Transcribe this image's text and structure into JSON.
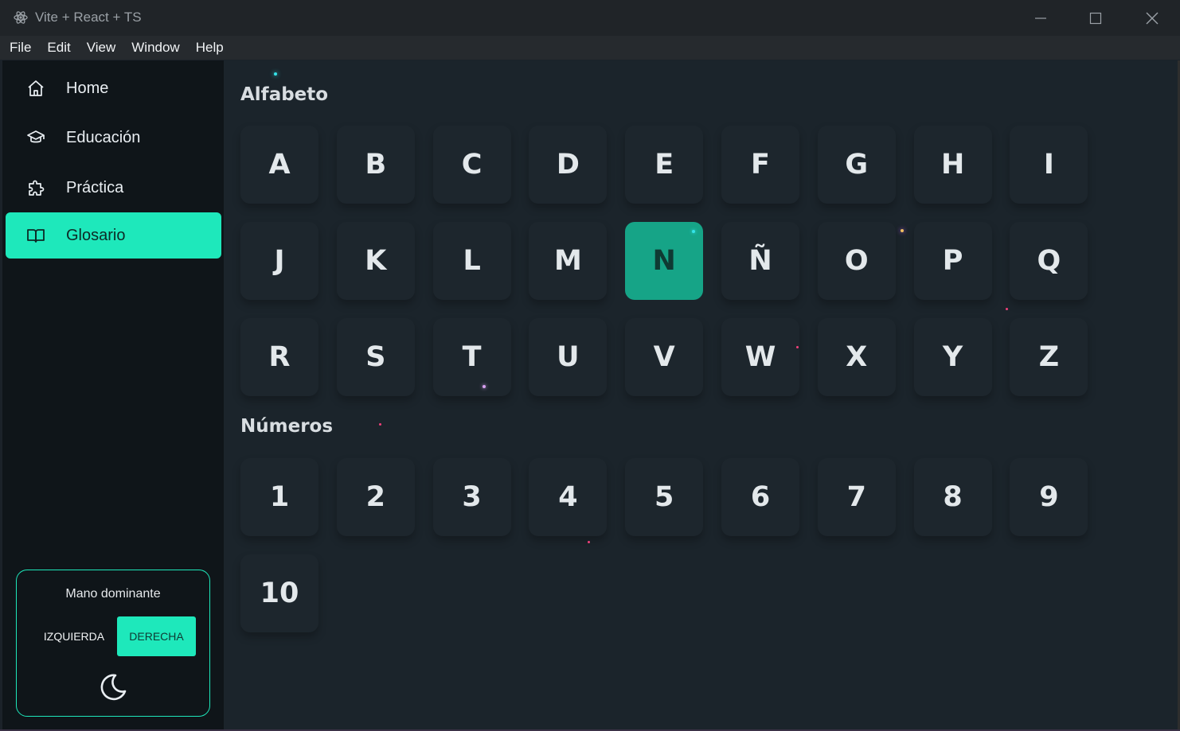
{
  "window": {
    "title": "Vite + React + TS"
  },
  "menu": [
    "File",
    "Edit",
    "View",
    "Window",
    "Help"
  ],
  "sidebar": {
    "items": [
      {
        "label": "Home",
        "icon": "home-icon"
      },
      {
        "label": "Educación",
        "icon": "graduation-cap-icon"
      },
      {
        "label": "Práctica",
        "icon": "puzzle-icon"
      },
      {
        "label": "Glosario",
        "icon": "book-open-icon",
        "active": true
      }
    ],
    "hand": {
      "title": "Mano dominante",
      "left_label": "IZQUIERDA",
      "right_label": "DERECHA",
      "selected": "DERECHA",
      "theme_icon": "moon-icon"
    }
  },
  "main": {
    "alphabet_title": "Alfabeto",
    "letters": [
      "A",
      "B",
      "C",
      "D",
      "E",
      "F",
      "G",
      "H",
      "I",
      "J",
      "K",
      "L",
      "M",
      "N",
      "Ñ",
      "O",
      "P",
      "Q",
      "R",
      "S",
      "T",
      "U",
      "V",
      "W",
      "X",
      "Y",
      "Z"
    ],
    "selected_letter": "N",
    "numbers_title": "Números",
    "numbers": [
      "1",
      "2",
      "3",
      "4",
      "5",
      "6",
      "7",
      "8",
      "9",
      "10"
    ]
  },
  "colors": {
    "accent": "#1ee8bb",
    "selected_tile": "#16a487",
    "sidebar_bg": "#0f1519",
    "main_bg": "#1b242b"
  }
}
